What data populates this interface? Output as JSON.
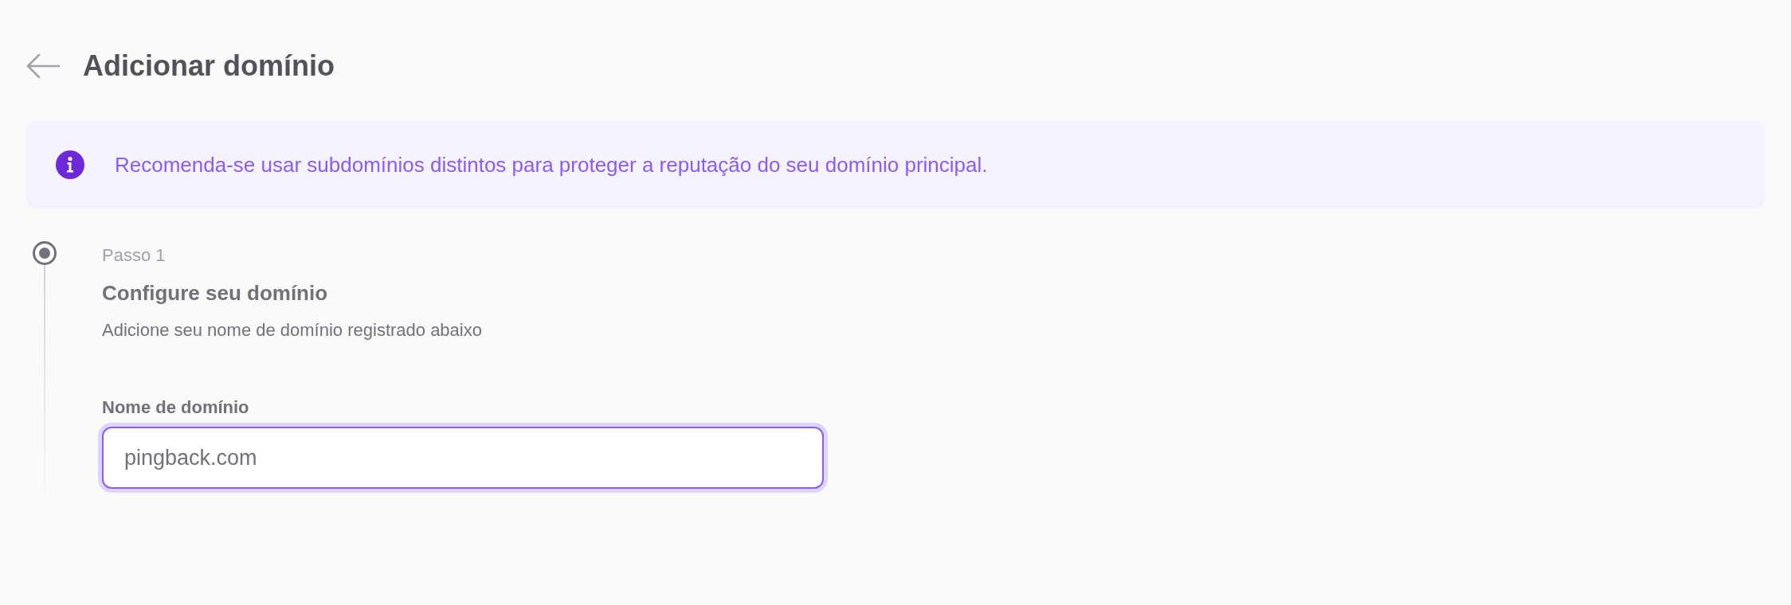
{
  "header": {
    "title": "Adicionar domínio"
  },
  "notice": {
    "text": "Recomenda-se usar subdomínios distintos para proteger a reputação do seu domínio principal."
  },
  "steps": [
    {
      "label": "Passo 1",
      "title": "Configure seu domínio",
      "description": "Adicione seu nome de domínio registrado abaixo",
      "active": true,
      "field": {
        "label": "Nome de domínio",
        "value": "pingback.com",
        "focused": true
      }
    }
  ]
}
